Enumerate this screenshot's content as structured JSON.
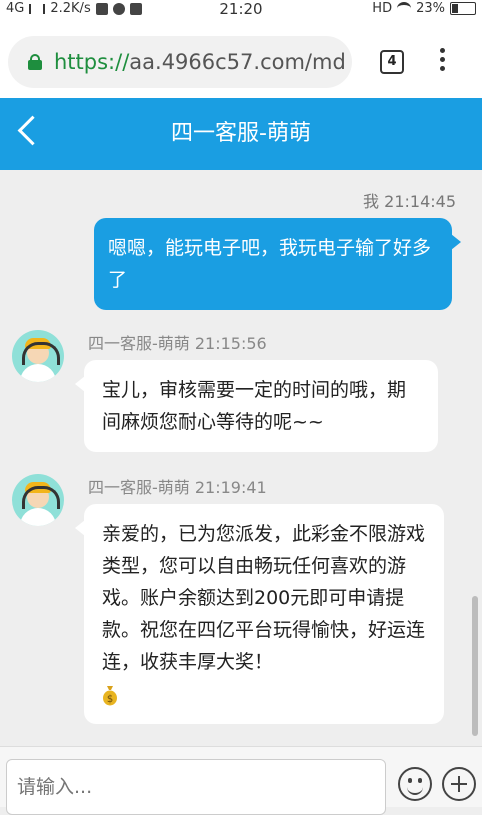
{
  "status_bar": {
    "network": "4G",
    "speed": "2.2K/s",
    "time": "21:20",
    "hd": "HD",
    "battery": "23%"
  },
  "browser": {
    "url_scheme": "https://",
    "url_rest": "aa.4966c57.com/md",
    "tab_count": "4"
  },
  "header": {
    "title": "四一客服-萌萌"
  },
  "messages": {
    "outgoing": {
      "meta": "我 21:14:45",
      "text": "嗯嗯，能玩电子吧，我玩电子输了好多了"
    },
    "incoming": [
      {
        "meta": "四一客服-萌萌 21:15:56",
        "text": "宝儿，审核需要一定的时间的哦，期间麻烦您耐心等待的呢~~"
      },
      {
        "meta": "四一客服-萌萌 21:19:41",
        "text": "亲爱的，已为您派发，此彩金不限游戏类型，您可以自由畅玩任何喜欢的游戏。账户余额达到200元即可申请提款。祝您在四亿平台玩得愉快，好运连连，收获丰厚大奖！",
        "icon": "money-bag-icon"
      }
    ]
  },
  "input": {
    "placeholder": "请输入..."
  },
  "colors": {
    "accent": "#1a9ee2",
    "secure_green": "#1e8e3e",
    "background": "#eeeeee"
  }
}
